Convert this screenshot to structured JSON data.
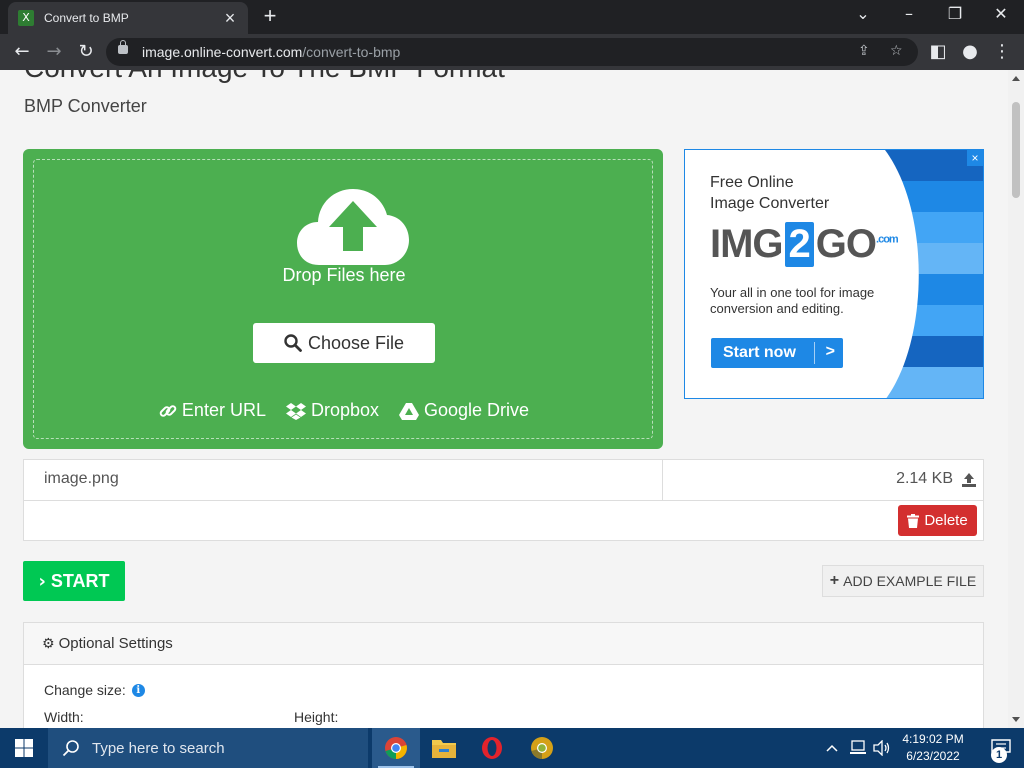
{
  "browser": {
    "tab_title": "Convert to BMP",
    "tab_favicon_letter": "X",
    "new_tab_label": "+",
    "url_host": "image.online-convert.com",
    "url_path": "/convert-to-bmp"
  },
  "page": {
    "heading": "Convert An Image To The BMP Format",
    "subheading": "BMP Converter"
  },
  "dropzone": {
    "drop_text": "Drop Files here",
    "choose_file": "Choose File",
    "links": {
      "enter_url": "Enter URL",
      "dropbox": "Dropbox",
      "google_drive": "Google Drive"
    },
    "color": "#4caf50"
  },
  "ad": {
    "line1": "Free Online",
    "line2": "Image Converter",
    "logo_left": "IMG",
    "logo_mid": "2",
    "logo_right": "GO",
    "logo_suffix": ".com",
    "description": "Your all in one tool for image conversion and editing.",
    "cta": "Start now",
    "close": "×",
    "accent": "#1e88e5"
  },
  "file": {
    "name": "image.png",
    "size": "2.14 KB",
    "delete_label": "Delete"
  },
  "actions": {
    "start_label": "START",
    "add_example_label": "ADD EXAMPLE FILE",
    "start_color": "#00c853"
  },
  "settings": {
    "title": "Optional Settings",
    "change_size": "Change size:",
    "width_label": "Width:",
    "height_label": "Height:"
  },
  "taskbar": {
    "search_text": "Type here to search",
    "time": "4:19:02 PM",
    "date": "6/23/2022",
    "notification_count": "1"
  }
}
